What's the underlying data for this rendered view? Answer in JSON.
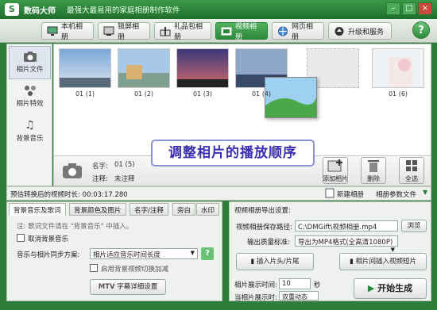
{
  "titlebar": {
    "logo_text": "S",
    "app_name": "数码大师",
    "slogan": "最强大最易用的家庭相册制作软件"
  },
  "nav": {
    "tabs": [
      {
        "label": "本机相册",
        "active": false
      },
      {
        "label": "锁屏相册",
        "active": false
      },
      {
        "label": "礼品包相册",
        "active": false
      },
      {
        "label": "视频相册",
        "active": true
      },
      {
        "label": "网页相册",
        "active": false
      },
      {
        "label": "升级和服务",
        "active": false
      }
    ],
    "help": "?"
  },
  "side": {
    "items": [
      "相片文件",
      "相片特效",
      "背景音乐"
    ]
  },
  "photos": {
    "labels": [
      "01 (1)",
      "01 (2)",
      "01 (3)",
      "01 (4)",
      "01 (6)"
    ],
    "name_label": "名字:",
    "name_value": "01 (5)",
    "note_label": "注释:",
    "note_value": "未注释",
    "actions": {
      "add": "添加相片",
      "delete": "删除",
      "select_all": "全选"
    }
  },
  "banner": {
    "text": "调整相片的播放顺序"
  },
  "status": {
    "duration": "预估转换后的视频时长: 00:03:17.280",
    "new_album": "新建相册",
    "album_param_file": "相册参数文件"
  },
  "left_panel": {
    "tabs": [
      "背景音乐及歌词",
      "背景颜色及图片",
      "名字/注释",
      "旁白",
      "水印"
    ],
    "hint": "注: 歌词文件请在 \"背景音乐\" 中插入。",
    "cancel_music": "取消背景音乐",
    "sync_label": "音乐与相片同步方案:",
    "sync_value": "相片适应音乐时间长度",
    "fade_label": "启用背景视频切换加减",
    "mtv_prefix": "MTV",
    "mtv_label": "字幕详细设置"
  },
  "right_panel": {
    "title": "视频相册导出设置:",
    "path_label": "视频相册保存路径:",
    "path_value": "C:\\DMGift\\视频相册.mp4",
    "browse": "浏览",
    "quality_label": "输出质量标准:",
    "quality_value": "导出为MP4格式(全高清1080P)",
    "insert_head": "插入片头/片尾",
    "insert_clip": "相片间插入视频短片",
    "interval_label": "相片展示时间:",
    "interval_value": "10",
    "interval_unit": "秒",
    "transition_label": "当相片展示时:",
    "transition_value": "双重动态",
    "start": "开始生成"
  }
}
